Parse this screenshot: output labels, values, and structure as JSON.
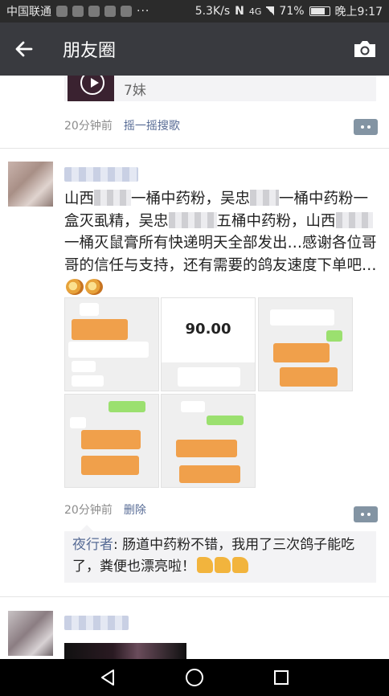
{
  "status_bar": {
    "carrier": "中国联通",
    "net_speed": "5.3K/s",
    "signal": "4G",
    "battery": "71%",
    "battery_level": 0.71,
    "time": "晚上9:17"
  },
  "header": {
    "title": "朋友圈"
  },
  "prev_post": {
    "shared_title": "7妹",
    "time": "20分钟前",
    "source_link": "摇一摇搜歌"
  },
  "post": {
    "text_1": "山西",
    "text_2": "一桶中药粉，吴忠",
    "text_3": "一桶中药粉一盒灭虱精，吴忠",
    "text_4": "五桶中药粉，山西",
    "text_5": "一桶灭鼠膏所有快递明天全部发出…感谢各位哥哥的信任与支持，还有需要的鸽友速度下单吧…",
    "time": "20分钟前",
    "delete_label": "删除",
    "payment_amount": "90.00",
    "comment": {
      "author": "夜行者",
      "text": ": 肠道中药粉不错，我用了三次鸽子能吃了，粪便也漂亮啦！"
    }
  },
  "nav": {
    "back": "back-triangle",
    "home": "home-circle",
    "recents": "recents-square"
  }
}
